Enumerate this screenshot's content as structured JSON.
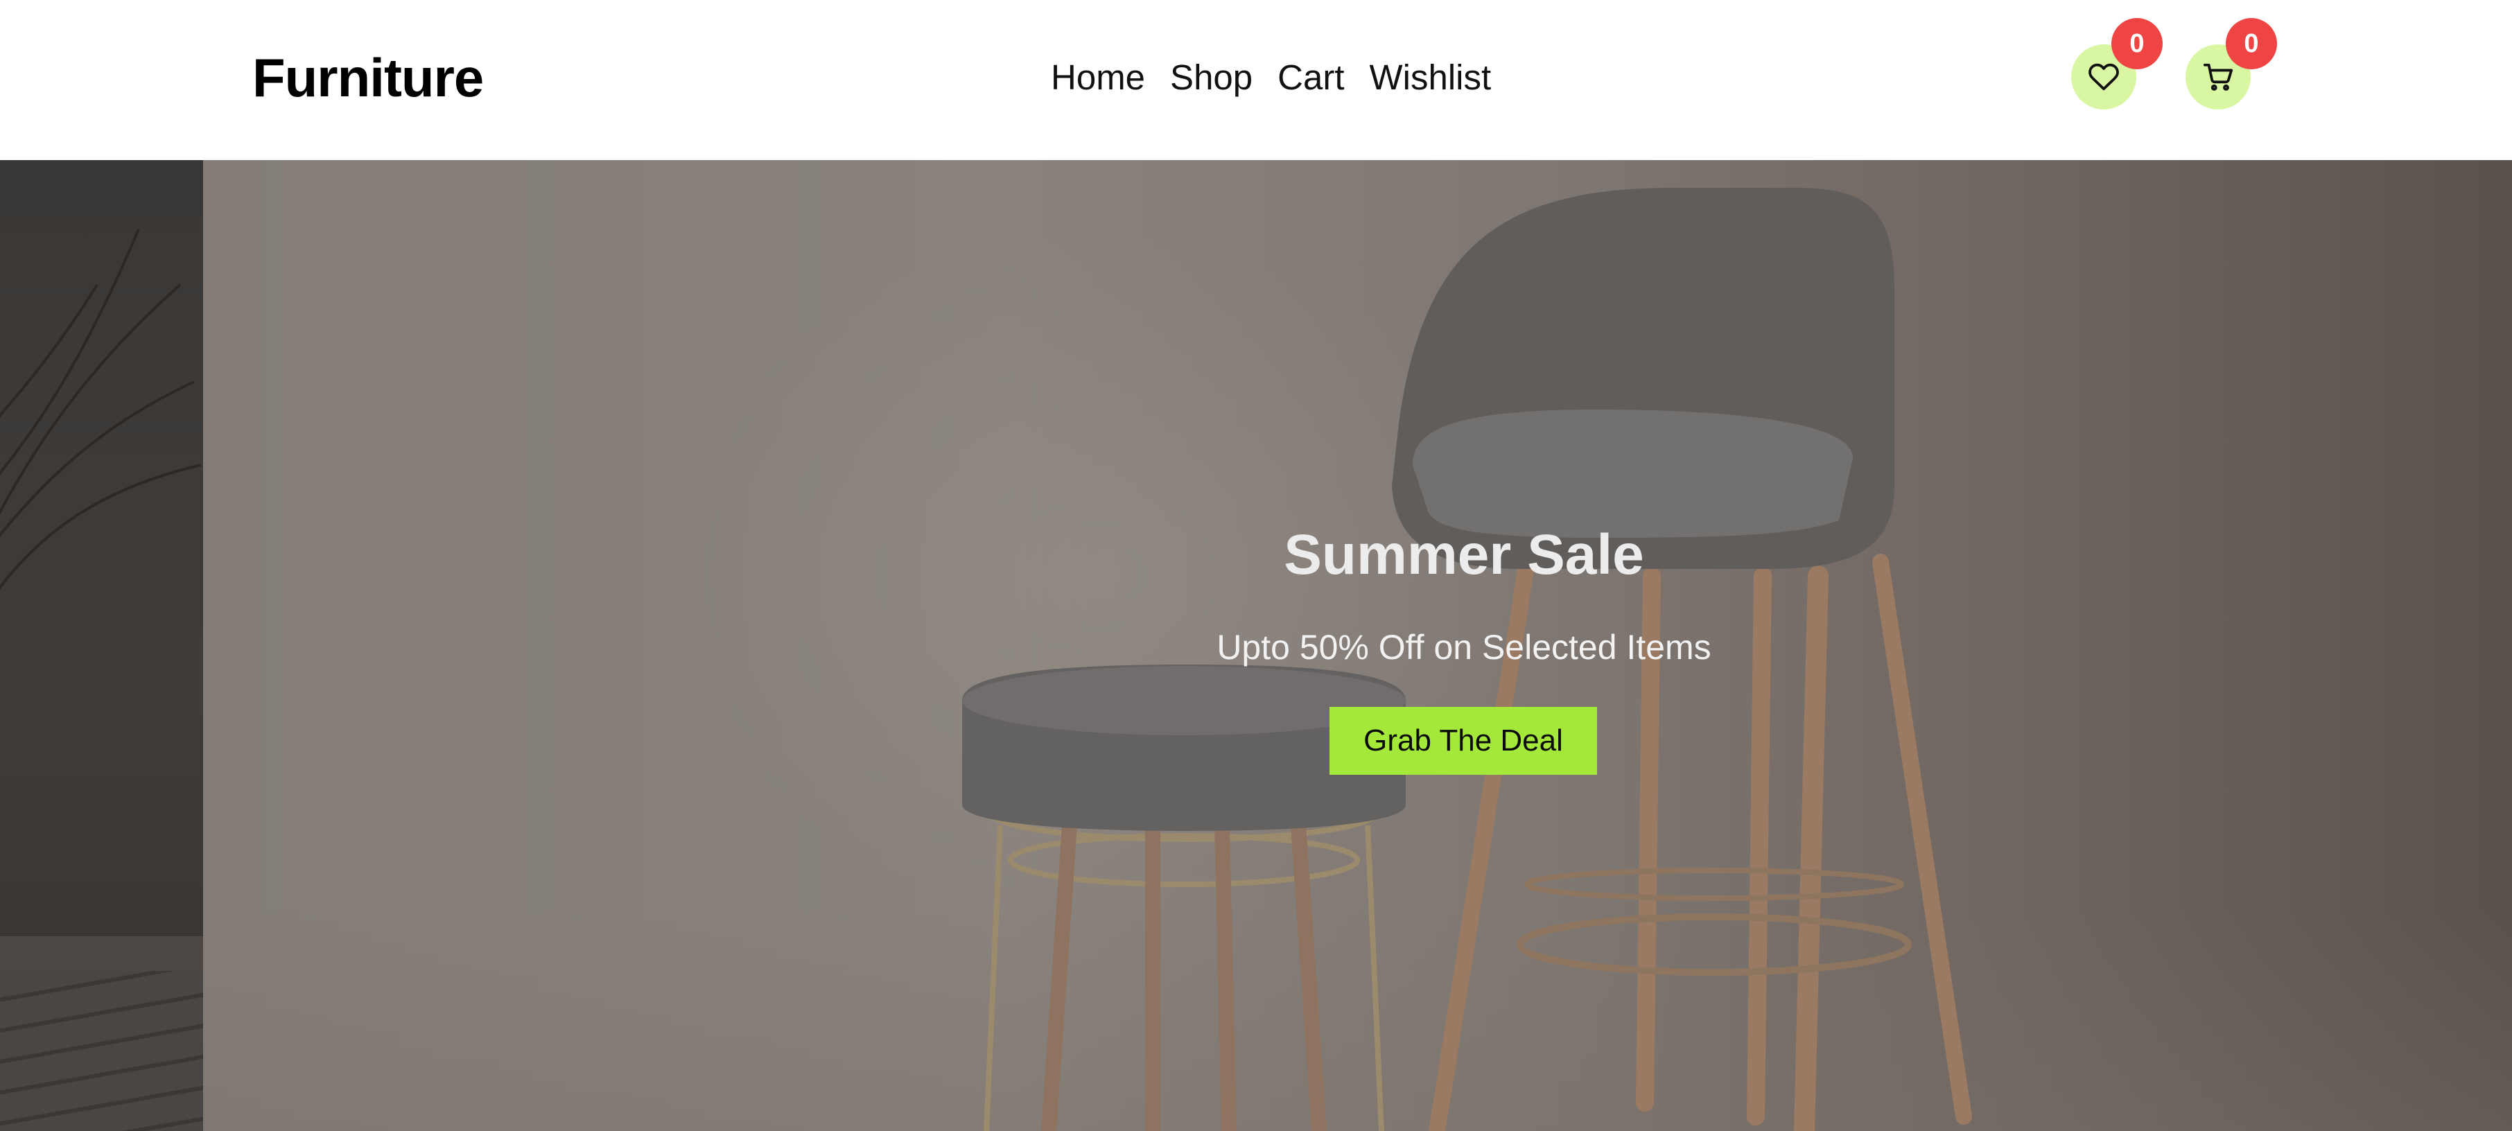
{
  "header": {
    "logo": "Furniture",
    "nav": [
      {
        "label": "Home"
      },
      {
        "label": "Shop"
      },
      {
        "label": "Cart"
      },
      {
        "label": "Wishlist"
      }
    ],
    "wishlist_count": "0",
    "cart_count": "0",
    "icons": {
      "wishlist": "heart-icon",
      "cart": "cart-icon"
    }
  },
  "hero": {
    "title": "Summer Sale",
    "subtitle": "Upto 50% Off on Selected Items",
    "cta_label": "Grab The Deal",
    "image": "bar-chair-and-stool-photo"
  },
  "colors": {
    "accent": "#a4e83a",
    "icon_bg": "#d9f7a3",
    "badge": "#ef4444",
    "hero_text": "#ececec"
  }
}
